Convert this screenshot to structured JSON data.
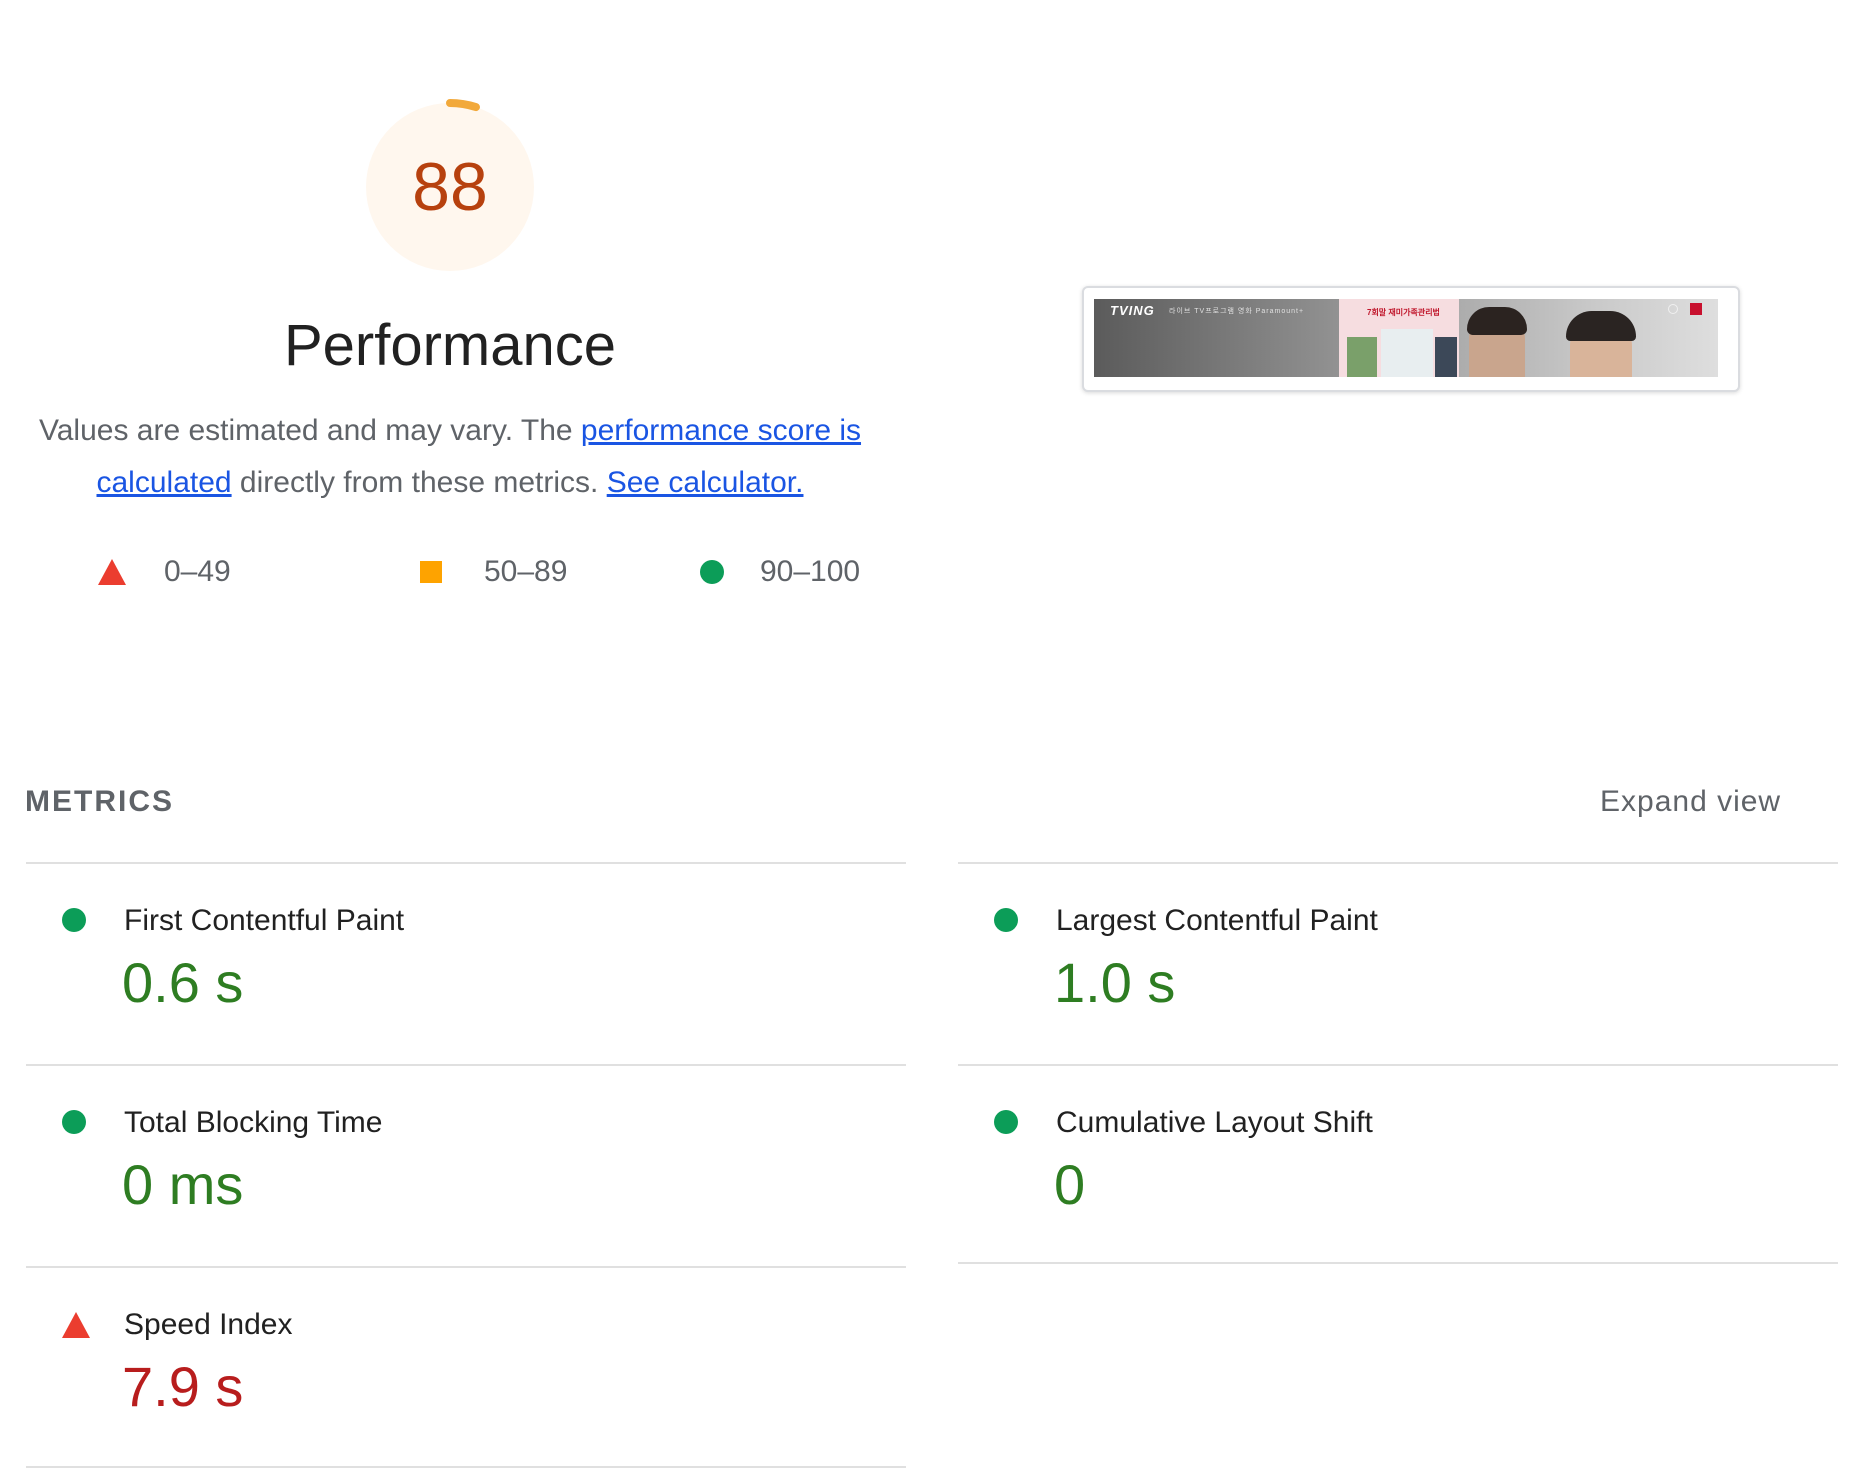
{
  "gauge": {
    "score": "88",
    "score_fraction": 0.88,
    "title": "Performance",
    "color": "#b7410e",
    "arc_color": "#f2a93b"
  },
  "description": {
    "text_1": "Values are estimated and may vary. The ",
    "link_1": "performance score is calculated",
    "text_2": " directly from these metrics. ",
    "link_2": "See calculator."
  },
  "legend": {
    "fail": {
      "label": "0–49",
      "icon": "red-triangle-icon",
      "color": "#eb3d2f"
    },
    "average": {
      "label": "50–89",
      "icon": "orange-square-icon",
      "color": "#fea300"
    },
    "pass": {
      "label": "90–100",
      "icon": "green-circle-icon",
      "color": "#0c9d58"
    }
  },
  "screenshot": {
    "logo": "TVING",
    "nav": "라이브  TV프로그램  영화  Paramount+",
    "poster_text": "7회말 재미가족관리법"
  },
  "metrics": {
    "title": "METRICS",
    "expand_label": "Expand view",
    "items": [
      {
        "label": "First Contentful Paint",
        "value": "0.6 s",
        "status": "pass"
      },
      {
        "label": "Largest Contentful Paint",
        "value": "1.0 s",
        "status": "pass"
      },
      {
        "label": "Total Blocking Time",
        "value": "0 ms",
        "status": "pass"
      },
      {
        "label": "Cumulative Layout Shift",
        "value": "0",
        "status": "pass"
      },
      {
        "label": "Speed Index",
        "value": "7.9 s",
        "status": "fail"
      }
    ]
  }
}
